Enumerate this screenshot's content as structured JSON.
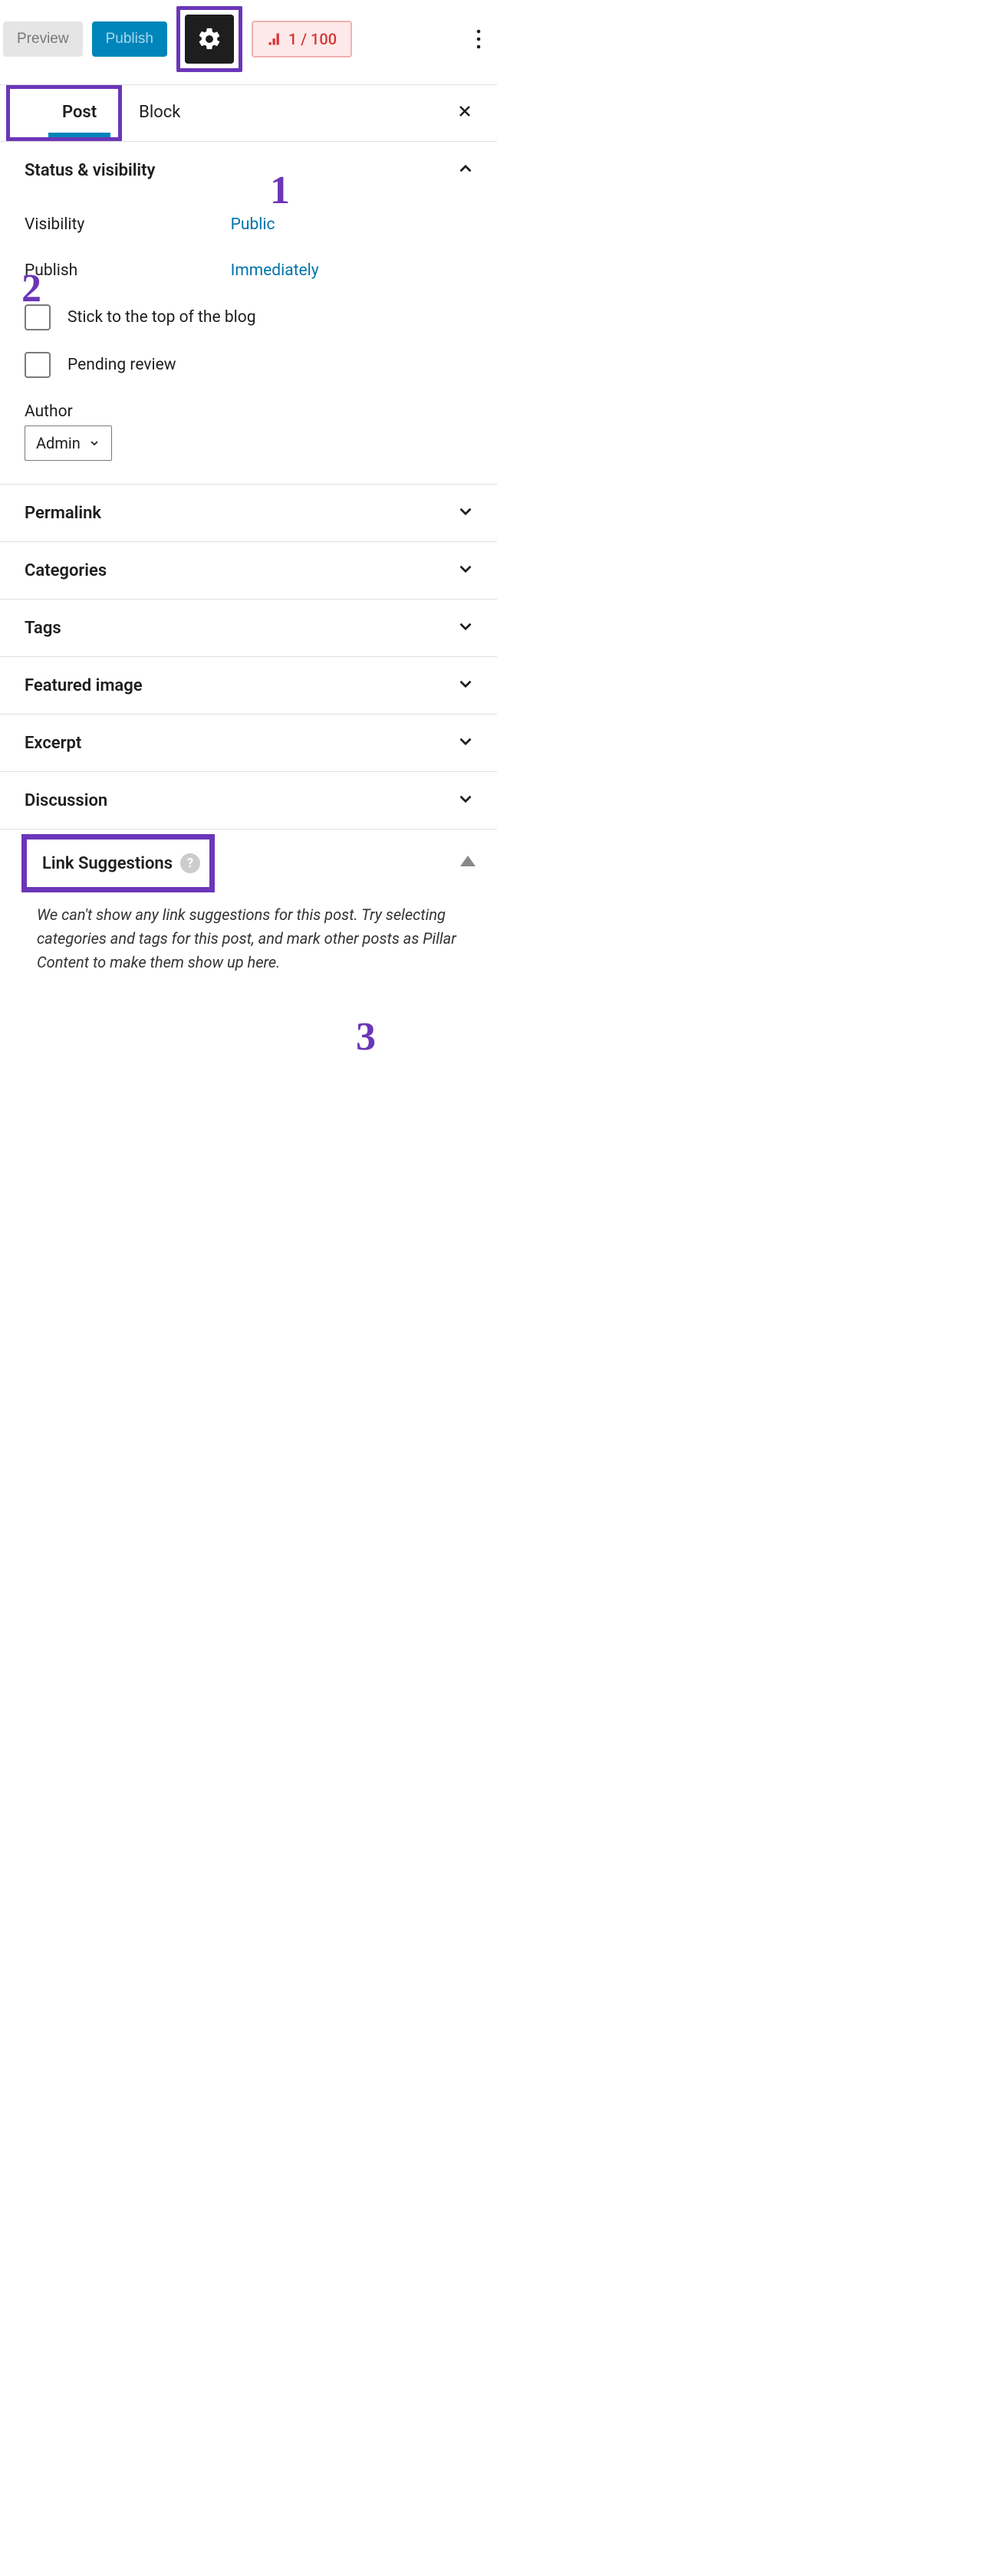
{
  "topbar": {
    "preview_label": "Preview",
    "publish_label": "Publish",
    "score_text": "1 / 100"
  },
  "annotations": {
    "n1": "1",
    "n2": "2",
    "n3": "3"
  },
  "tabs": {
    "post": "Post",
    "block": "Block"
  },
  "sections": {
    "status_visibility": {
      "title": "Status & visibility",
      "visibility_label": "Visibility",
      "visibility_value": "Public",
      "publish_label": "Publish",
      "publish_value": "Immediately",
      "stick_label": "Stick to the top of the blog",
      "pending_label": "Pending review",
      "author_label": "Author",
      "author_value": "Admin"
    },
    "permalink": "Permalink",
    "categories": "Categories",
    "tags": "Tags",
    "featured_image": "Featured image",
    "excerpt": "Excerpt",
    "discussion": "Discussion",
    "link_suggestions": {
      "title": "Link Suggestions",
      "help": "?",
      "body": "We can't show any link suggestions for this post. Try selecting categories and tags for this post, and mark other posts as Pillar Content to make them show up here."
    }
  }
}
